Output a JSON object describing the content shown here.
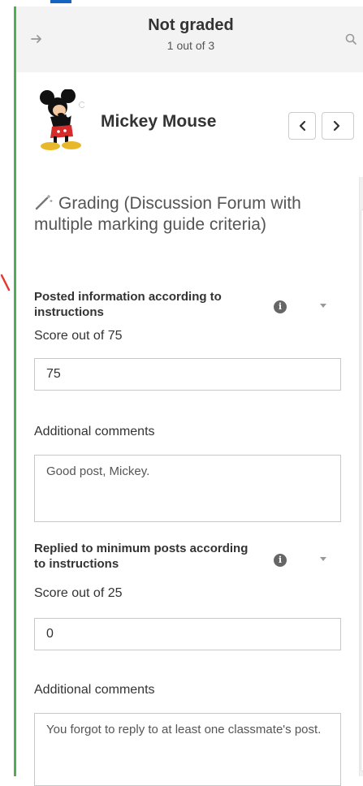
{
  "header": {
    "status_title": "Not graded",
    "status_sub": "1 out of 3"
  },
  "student": {
    "name": "Mickey Mouse"
  },
  "grading": {
    "title": "Grading (Discussion Forum with multiple marking guide criteria)",
    "criteria": [
      {
        "title": "Posted information according to instructions",
        "score_label": "Score out of 75",
        "score_value": "75",
        "comments_label": "Additional comments",
        "comments_value": "Good post, Mickey."
      },
      {
        "title": "Replied to minimum posts according to instructions",
        "score_label": "Score out of 25",
        "score_value": "0",
        "comments_label": "Additional comments",
        "comments_value": "You forgot to reply to at least one classmate's post."
      }
    ]
  },
  "colors": {
    "accent_blue": "#1565c0",
    "accent_green": "#4caf50",
    "annotation_red": "#e53935"
  },
  "icons": {
    "collapse": "arrow-right-icon",
    "search": "search-icon",
    "prev": "chevron-left-icon",
    "next": "chevron-right-icon",
    "grading": "magic-wand-icon",
    "info": "info-icon",
    "expand": "caret-down-icon"
  }
}
